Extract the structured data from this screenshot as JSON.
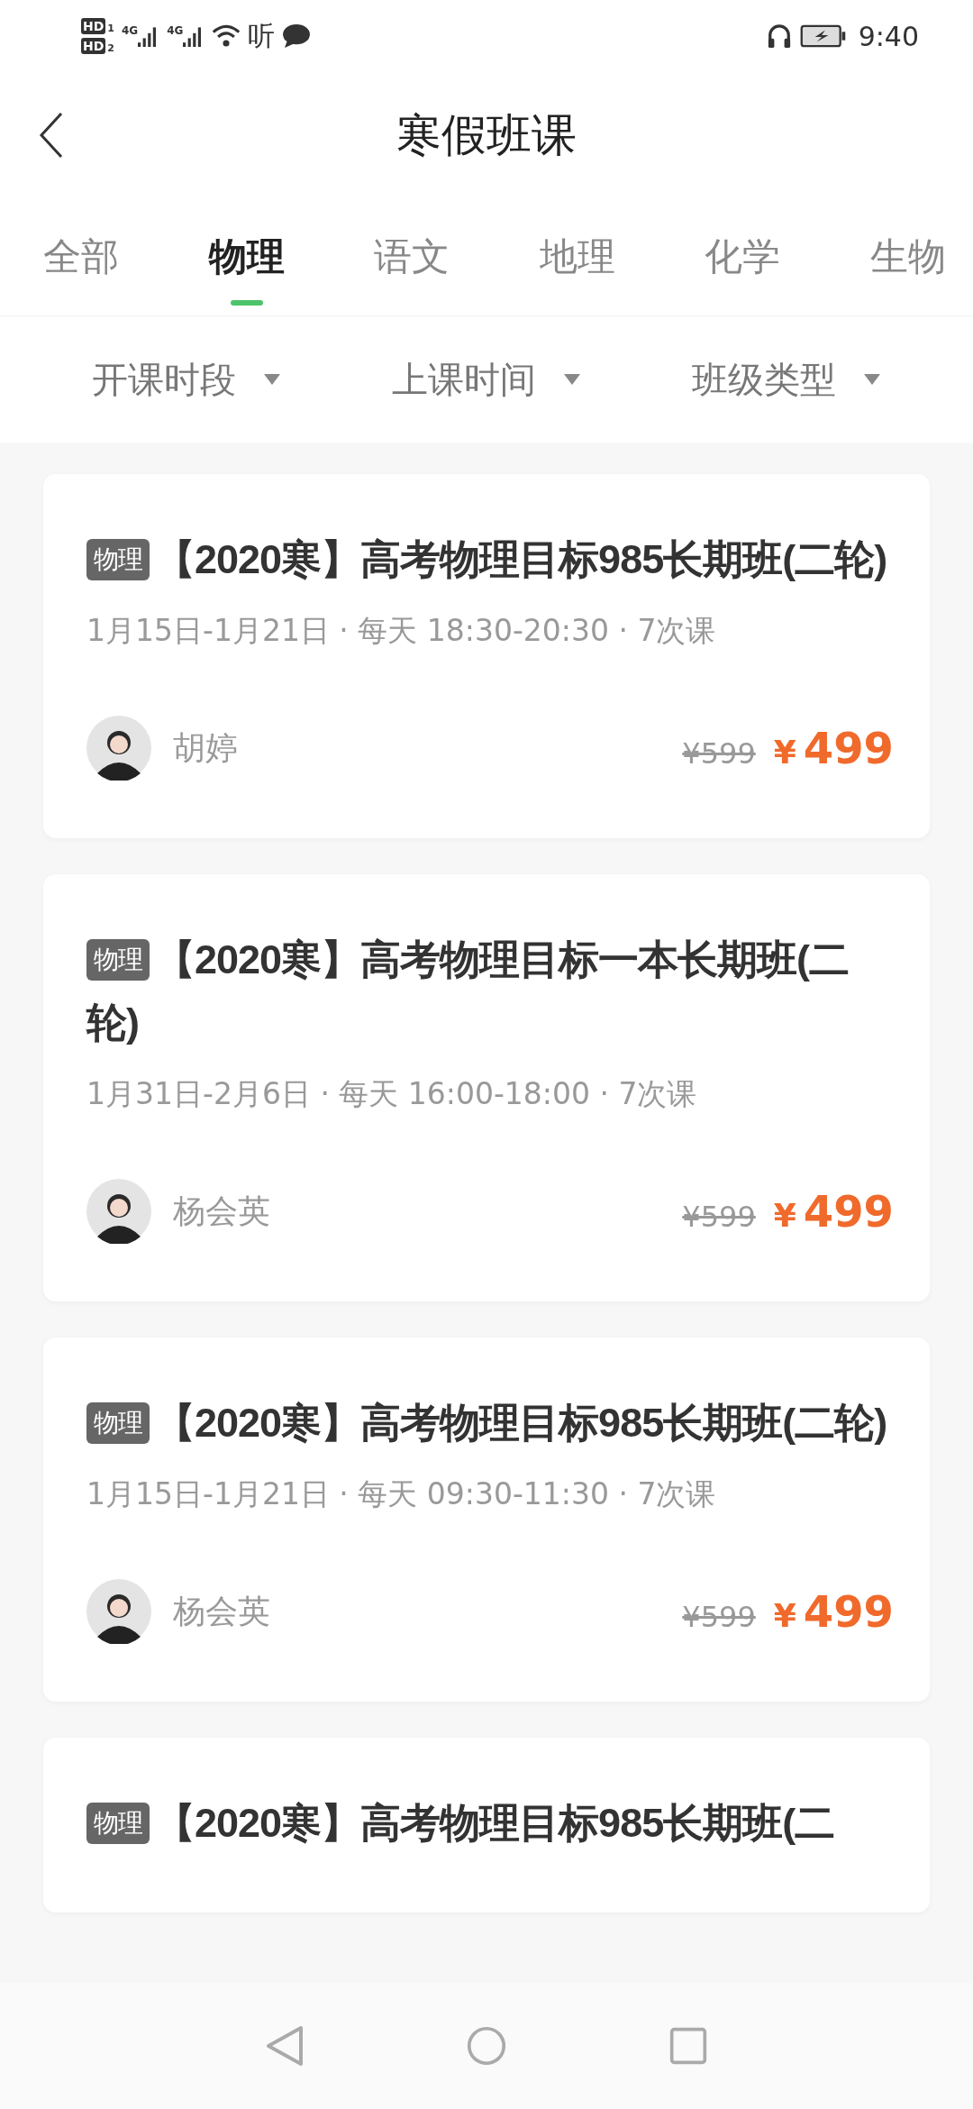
{
  "status_bar": {
    "sims": [
      {
        "label": "HD",
        "slot": "1"
      },
      {
        "label": "HD",
        "slot": "2"
      }
    ],
    "networks": [
      "4G",
      "4G"
    ],
    "extra": "听",
    "time": "9:40"
  },
  "nav": {
    "title": "寒假班课"
  },
  "tabs": [
    {
      "label": "全部",
      "selected": false
    },
    {
      "label": "物理",
      "selected": true
    },
    {
      "label": "语文",
      "selected": false
    },
    {
      "label": "地理",
      "selected": false
    },
    {
      "label": "化学",
      "selected": false
    },
    {
      "label": "生物",
      "selected": false
    }
  ],
  "filters": [
    "开课时段",
    "上课时间",
    "班级类型"
  ],
  "courses": [
    {
      "tag": "物理",
      "title": "【2020寒】高考物理目标985长期班(二轮)",
      "schedule": "1月15日-1月21日 · 每天 18:30-20:30 · 7次课",
      "teacher": "胡婷",
      "old_price": "¥599",
      "currency": "¥",
      "price": "499"
    },
    {
      "tag": "物理",
      "title": "【2020寒】高考物理目标一本长期班(二轮)",
      "schedule": "1月31日-2月6日 · 每天 16:00-18:00 · 7次课",
      "teacher": "杨会英",
      "old_price": "¥599",
      "currency": "¥",
      "price": "499"
    },
    {
      "tag": "物理",
      "title": "【2020寒】高考物理目标985长期班(二轮)",
      "schedule": "1月15日-1月21日 · 每天 09:30-11:30 · 7次课",
      "teacher": "杨会英",
      "old_price": "¥599",
      "currency": "¥",
      "price": "499"
    },
    {
      "tag": "物理",
      "title": "【2020寒】高考物理目标985长期班(二"
    }
  ]
}
